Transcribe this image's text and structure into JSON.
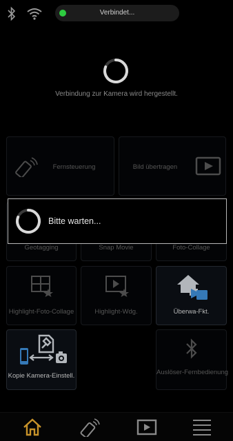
{
  "status": {
    "connection_label": "Verbindet...",
    "bluetooth_icon": "bluetooth-icon",
    "wifi_icon": "wifi-icon"
  },
  "connecting": {
    "message": "Verbindung zur Kamera wird hergestellt."
  },
  "tiles": {
    "remote": "Fernsteuerung",
    "image_transfer": "Bild übertragen",
    "geotagging": "Geotagging",
    "snap_movie": "Snap Movie",
    "photo_collage": "Foto-Collage",
    "highlight_collage": "Highlight-Foto-Collage",
    "highlight_play": "Highlight-Wdg.",
    "monitoring": "Überwa-Fkt.",
    "copy_settings": "Kopie Kamera-Einstell.",
    "shutter_remote": "Auslöser-Fernbedienung"
  },
  "dialog": {
    "message": "Bitte warten..."
  },
  "nav": {
    "home_icon": "home-icon",
    "remote_icon": "remote-icon",
    "playback_icon": "play-icon",
    "menu_icon": "menu-icon",
    "accent_color": "#c8932a"
  }
}
